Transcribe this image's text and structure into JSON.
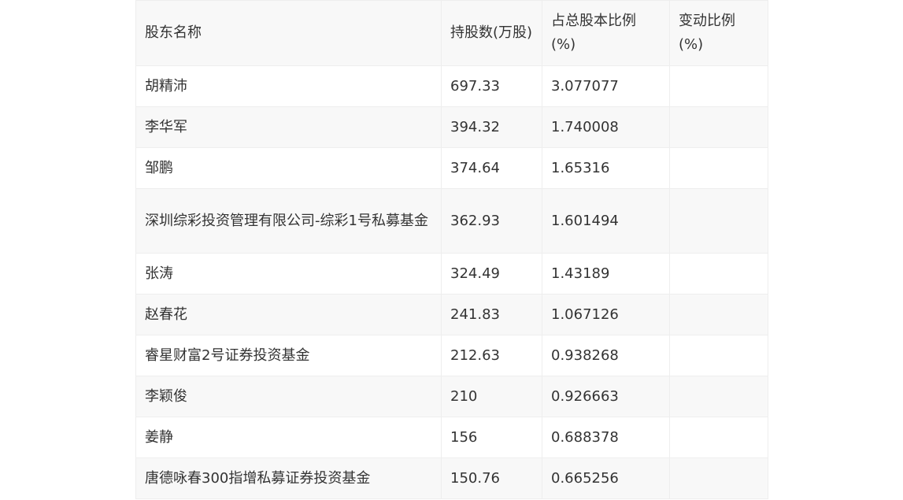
{
  "table": {
    "headers": [
      "股东名称",
      "持股数(万股)",
      "占总股本比例(%)",
      "变动比例(%)"
    ],
    "rows": [
      [
        "胡精沛",
        "697.33",
        "3.077077",
        ""
      ],
      [
        "李华军",
        "394.32",
        "1.740008",
        ""
      ],
      [
        "邹鹏",
        "374.64",
        "1.65316",
        ""
      ],
      [
        "深圳综彩投资管理有限公司-综彩1号私募基金",
        "362.93",
        "1.601494",
        ""
      ],
      [
        "张涛",
        "324.49",
        "1.43189",
        ""
      ],
      [
        "赵春花",
        "241.83",
        "1.067126",
        ""
      ],
      [
        "睿星财富2号证券投资基金",
        "212.63",
        "0.938268",
        ""
      ],
      [
        "李颖俊",
        "210",
        "0.926663",
        ""
      ],
      [
        "姜静",
        "156",
        "0.688378",
        ""
      ],
      [
        "唐德咏春300指增私募证券投资基金",
        "150.76",
        "0.665256",
        ""
      ]
    ]
  }
}
